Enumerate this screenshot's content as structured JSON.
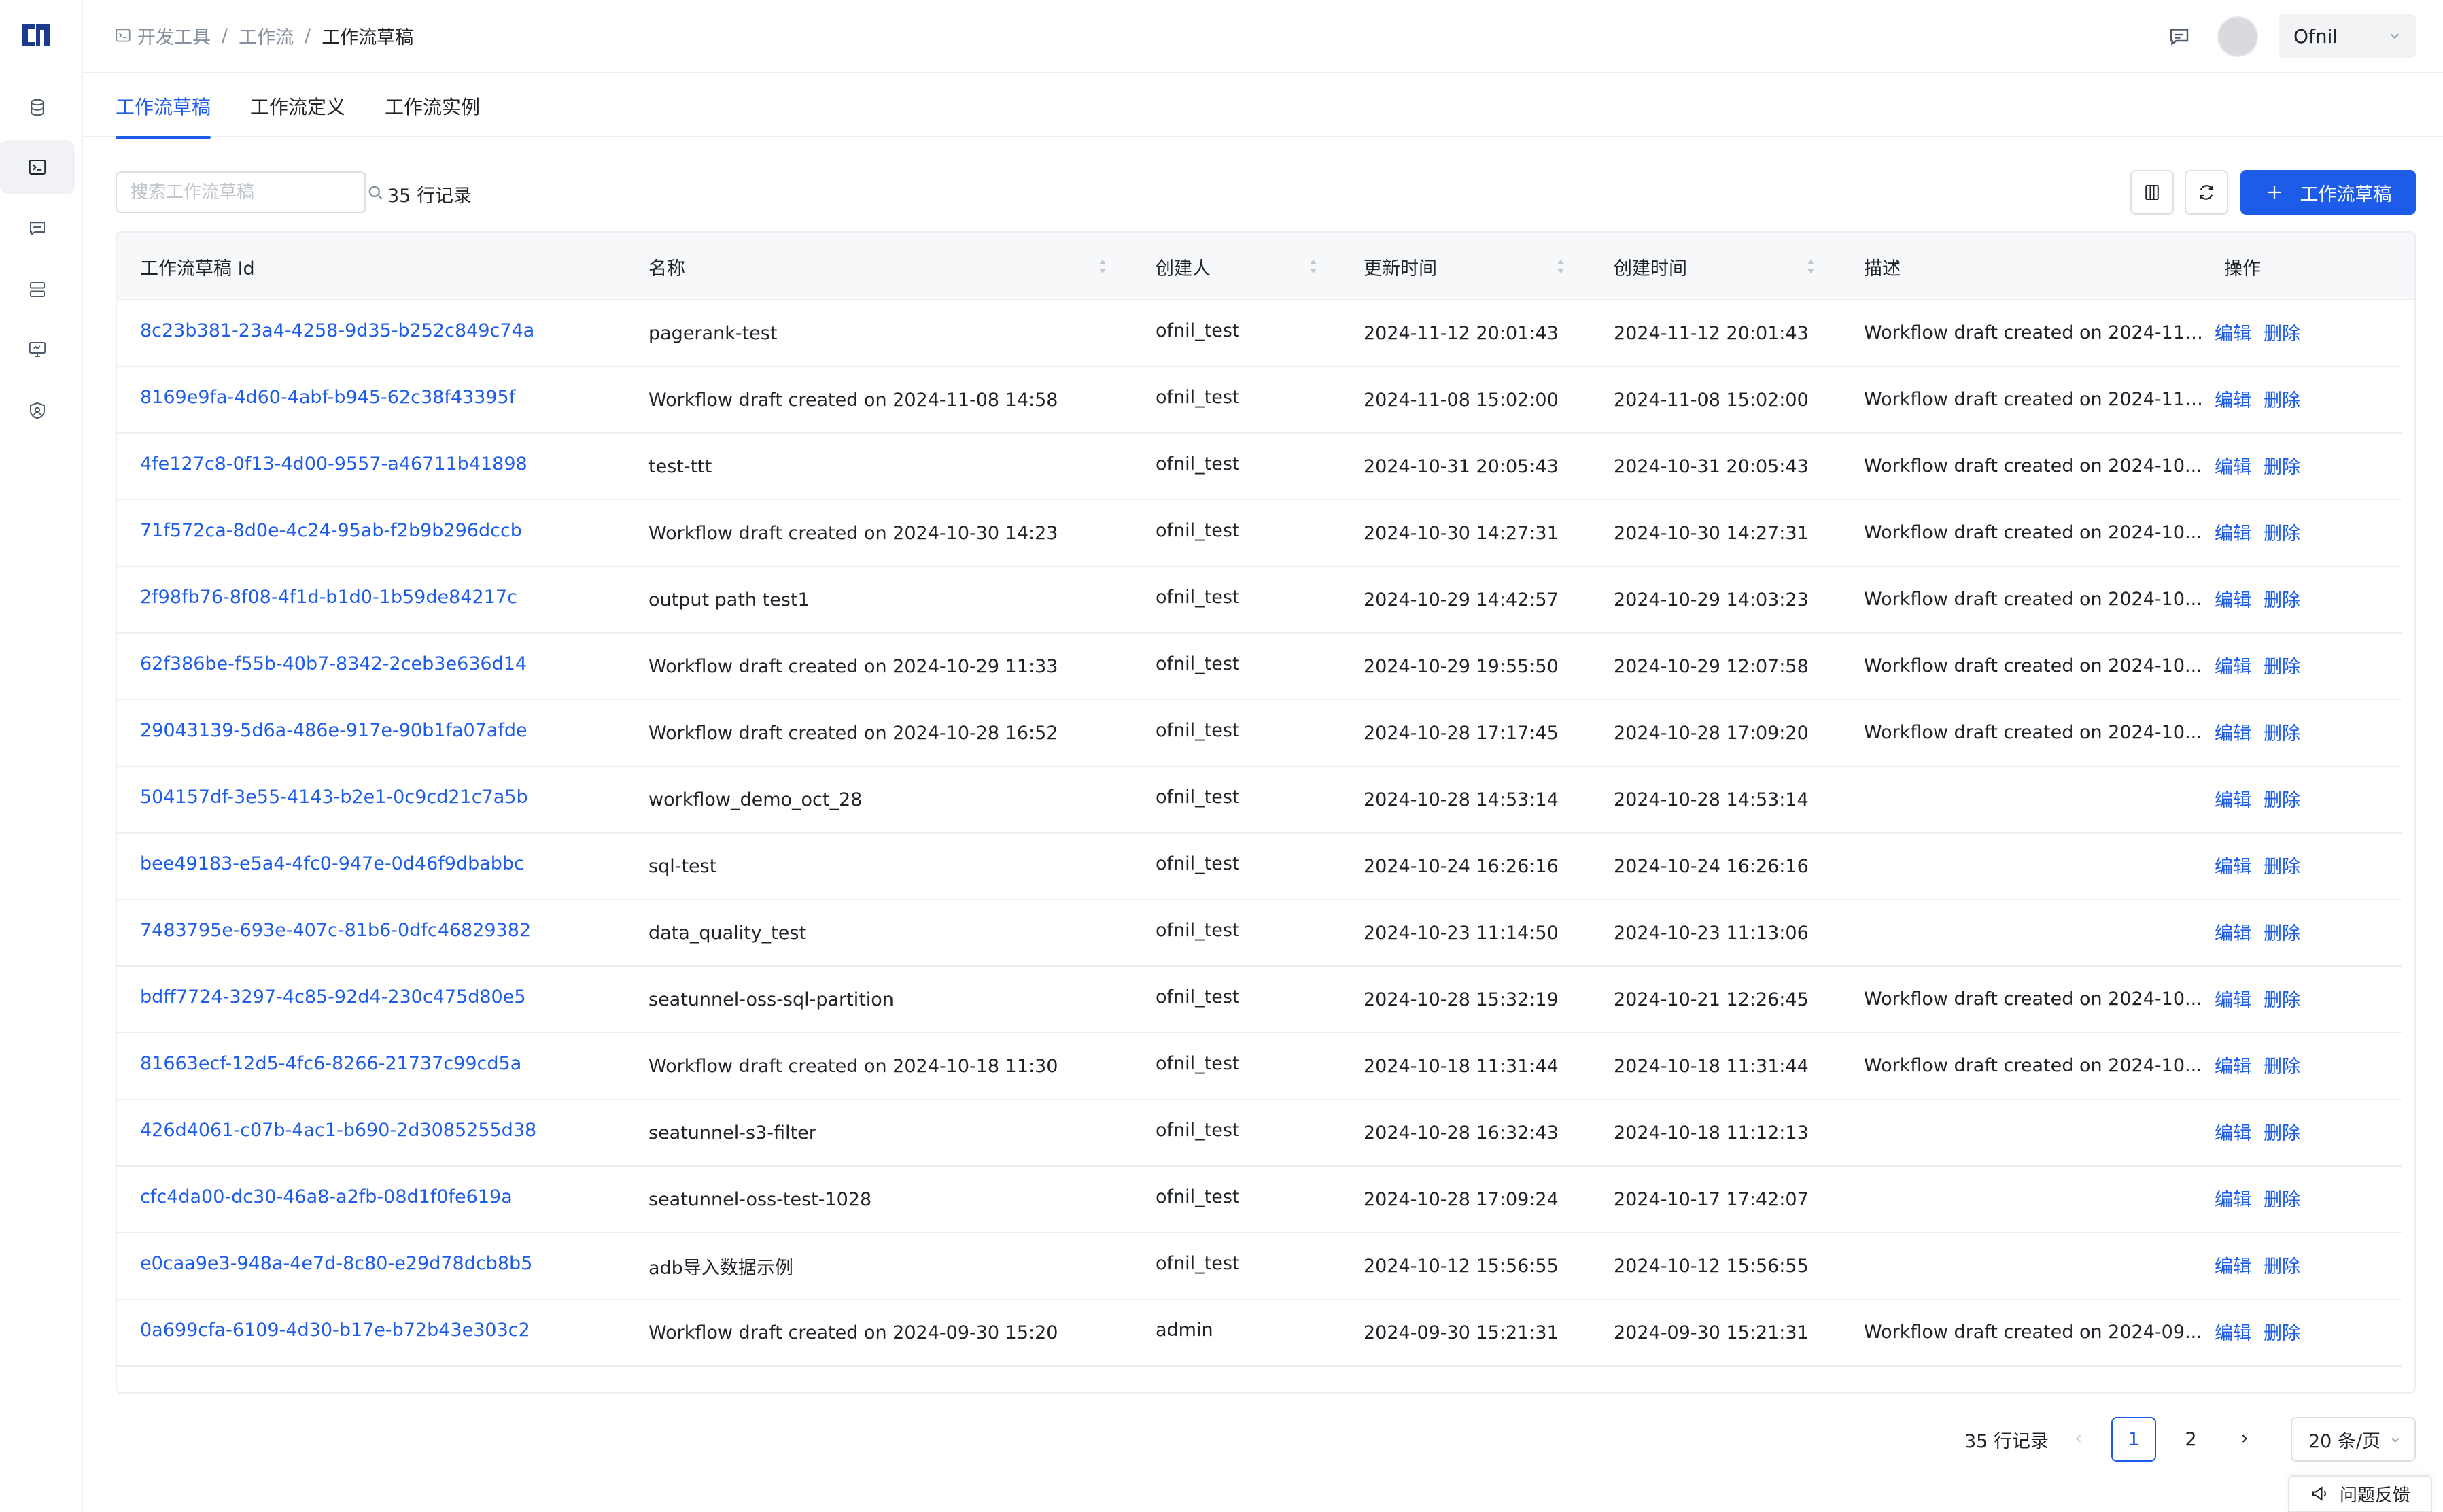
{
  "breadcrumb": [
    "开发工具",
    "工作流",
    "工作流草稿"
  ],
  "user": {
    "name": "Ofnil"
  },
  "tabs": [
    "工作流草稿",
    "工作流定义",
    "工作流实例"
  ],
  "toolbar": {
    "search_placeholder": "搜索工作流草稿",
    "record_count": "35 行记录",
    "create_label": "工作流草稿"
  },
  "table": {
    "headers": [
      "工作流草稿 Id",
      "名称",
      "创建人",
      "更新时间",
      "创建时间",
      "描述",
      "操作"
    ],
    "action_edit": "编辑",
    "action_delete": "删除",
    "rows": [
      {
        "id": "8c23b381-23a4-4258-9d35-b252c849c74a",
        "name": "pagerank-test",
        "creator": "ofnil_test",
        "updated": "2024-11-12 20:01:43",
        "created": "2024-11-12 20:01:43",
        "desc": "Workflow draft created on 2024-11-..."
      },
      {
        "id": "8169e9fa-4d60-4abf-b945-62c38f43395f",
        "name": "Workflow draft created on 2024-11-08 14:58",
        "creator": "ofnil_test",
        "updated": "2024-11-08 15:02:00",
        "created": "2024-11-08 15:02:00",
        "desc": "Workflow draft created on 2024-11-..."
      },
      {
        "id": "4fe127c8-0f13-4d00-9557-a46711b41898",
        "name": "test-ttt",
        "creator": "ofnil_test",
        "updated": "2024-10-31 20:05:43",
        "created": "2024-10-31 20:05:43",
        "desc": "Workflow draft created on 2024-10..."
      },
      {
        "id": "71f572ca-8d0e-4c24-95ab-f2b9b296dccb",
        "name": "Workflow draft created on 2024-10-30 14:23",
        "creator": "ofnil_test",
        "updated": "2024-10-30 14:27:31",
        "created": "2024-10-30 14:27:31",
        "desc": "Workflow draft created on 2024-10..."
      },
      {
        "id": "2f98fb76-8f08-4f1d-b1d0-1b59de84217c",
        "name": "output path test1",
        "creator": "ofnil_test",
        "updated": "2024-10-29 14:42:57",
        "created": "2024-10-29 14:03:23",
        "desc": "Workflow draft created on 2024-10..."
      },
      {
        "id": "62f386be-f55b-40b7-8342-2ceb3e636d14",
        "name": "Workflow draft created on 2024-10-29 11:33",
        "creator": "ofnil_test",
        "updated": "2024-10-29 19:55:50",
        "created": "2024-10-29 12:07:58",
        "desc": "Workflow draft created on 2024-10..."
      },
      {
        "id": "29043139-5d6a-486e-917e-90b1fa07afde",
        "name": "Workflow draft created on 2024-10-28 16:52",
        "creator": "ofnil_test",
        "updated": "2024-10-28 17:17:45",
        "created": "2024-10-28 17:09:20",
        "desc": "Workflow draft created on 2024-10..."
      },
      {
        "id": "504157df-3e55-4143-b2e1-0c9cd21c7a5b",
        "name": "workflow_demo_oct_28",
        "creator": "ofnil_test",
        "updated": "2024-10-28 14:53:14",
        "created": "2024-10-28 14:53:14",
        "desc": ""
      },
      {
        "id": "bee49183-e5a4-4fc0-947e-0d46f9dbabbc",
        "name": "sql-test",
        "creator": "ofnil_test",
        "updated": "2024-10-24 16:26:16",
        "created": "2024-10-24 16:26:16",
        "desc": ""
      },
      {
        "id": "7483795e-693e-407c-81b6-0dfc46829382",
        "name": "data_quality_test",
        "creator": "ofnil_test",
        "updated": "2024-10-23 11:14:50",
        "created": "2024-10-23 11:13:06",
        "desc": ""
      },
      {
        "id": "bdff7724-3297-4c85-92d4-230c475d80e5",
        "name": "seatunnel-oss-sql-partition",
        "creator": "ofnil_test",
        "updated": "2024-10-28 15:32:19",
        "created": "2024-10-21 12:26:45",
        "desc": "Workflow draft created on 2024-10..."
      },
      {
        "id": "81663ecf-12d5-4fc6-8266-21737c99cd5a",
        "name": "Workflow draft created on 2024-10-18 11:30",
        "creator": "ofnil_test",
        "updated": "2024-10-18 11:31:44",
        "created": "2024-10-18 11:31:44",
        "desc": "Workflow draft created on 2024-10..."
      },
      {
        "id": "426d4061-c07b-4ac1-b690-2d3085255d38",
        "name": "seatunnel-s3-filter",
        "creator": "ofnil_test",
        "updated": "2024-10-28 16:32:43",
        "created": "2024-10-18 11:12:13",
        "desc": ""
      },
      {
        "id": "cfc4da00-dc30-46a8-a2fb-08d1f0fe619a",
        "name": "seatunnel-oss-test-1028",
        "creator": "ofnil_test",
        "updated": "2024-10-28 17:09:24",
        "created": "2024-10-17 17:42:07",
        "desc": ""
      },
      {
        "id": "e0caa9e3-948a-4e7d-8c80-e29d78dcb8b5",
        "name": "adb导入数据示例",
        "creator": "ofnil_test",
        "updated": "2024-10-12 15:56:55",
        "created": "2024-10-12 15:56:55",
        "desc": ""
      },
      {
        "id": "0a699cfa-6109-4d30-b17e-b72b43e303c2",
        "name": "Workflow draft created on 2024-09-30 15:20",
        "creator": "admin",
        "updated": "2024-09-30 15:21:31",
        "created": "2024-09-30 15:21:31",
        "desc": "Workflow draft created on 2024-09..."
      }
    ]
  },
  "pagination": {
    "total": "35 行记录",
    "pages": [
      "1",
      "2"
    ],
    "current": "1",
    "page_size": "20 条/页"
  },
  "feedback_label": "问题反馈",
  "colors": {
    "primary": "#1d5ce8",
    "border": "#eceef2",
    "header_bg": "#f7f8fa"
  }
}
